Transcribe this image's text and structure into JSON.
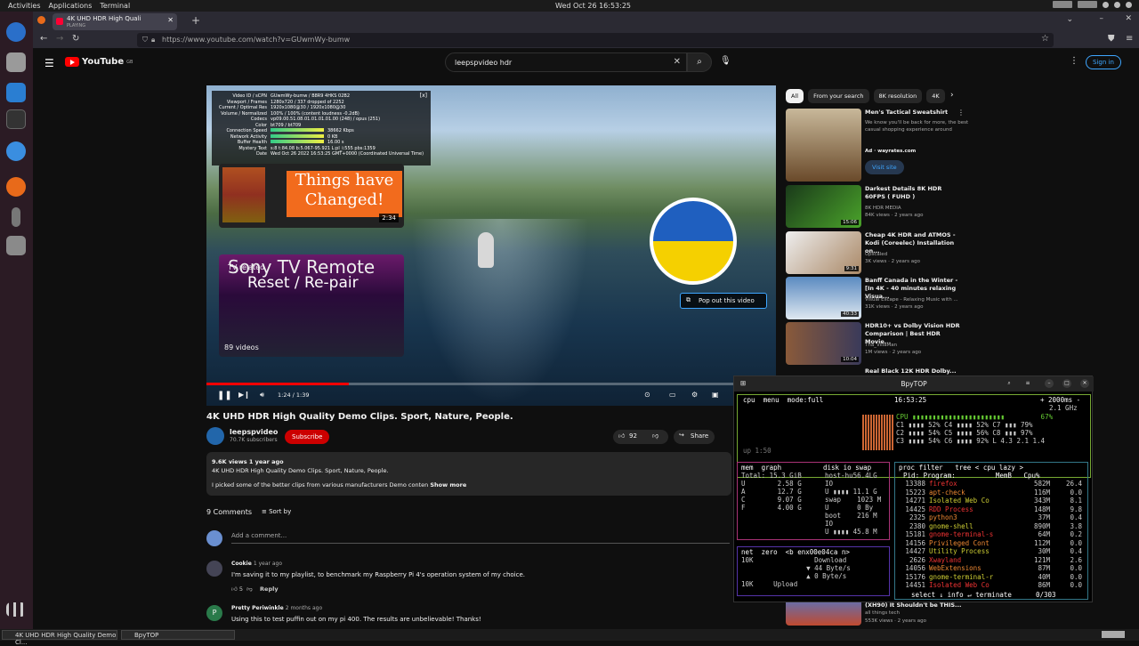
{
  "topbar": {
    "activities": "Activities",
    "applications": "Applications",
    "terminal": "Terminal",
    "clock": "Wed Oct 26  16:53:25"
  },
  "browser": {
    "tab_title": "4K UHD HDR High Quali",
    "tab_status": "PLAYING",
    "url": "https://www.youtube.com/watch?v=GUwmWy-bumw"
  },
  "yt": {
    "logo": "YouTube",
    "region": "GB",
    "search_value": "leepspvideo hdr",
    "signin": "Sign in",
    "video": {
      "stats": [
        [
          "Video ID / sCPN",
          "GUwmWy-bumw  /  B8R9  4HKS  02B2"
        ],
        [
          "Viewport / Frames",
          "1280x720 / 337 dropped of 2252"
        ],
        [
          "Current / Optimal Res",
          "1920x1080@30 / 1920x1080@30"
        ],
        [
          "Volume / Normalized",
          "100% / 100% (content loudness -0.2dB)"
        ],
        [
          "Codecs",
          "vp09.00.51.08.01.01.01.01.00 (248) / opus (251)"
        ],
        [
          "Color",
          "bt709 / bt709"
        ],
        [
          "Connection Speed",
          "38662 Kbps"
        ],
        [
          "Network Activity",
          "0 KB"
        ],
        [
          "Buffer Health",
          "16.00 s"
        ],
        [
          "Mystery Text",
          "s:8 t:84.08 b:5.067-95.921 L:pl_i:555 pbs:1359"
        ],
        [
          "Date",
          "Wed Oct 26 2022 16:53:25 GMT+0000 (Coordinated Universal Time)"
        ]
      ],
      "card1_text": "Things have Changed!",
      "card1_duration": "2:34",
      "card2_line1": "Sony TV Remote",
      "card2_line2": "Reset / Re-pair",
      "card2_tag": "TV related",
      "card2_count": "89 videos",
      "popout": "Pop out this video",
      "time": "1:24 / 1:39",
      "progress": 0.25
    },
    "title": "4K UHD HDR High Quality Demo Clips. Sport, Nature, People.",
    "channel": {
      "name": "leepspvideo",
      "subs": "70.7K subscribers",
      "subscribe": "Subscribe",
      "likes": "92",
      "share": "Share"
    },
    "desc": {
      "views": "9.6K views  1 year ago",
      "line1": "4K UHD HDR High Quality Demo Clips. Sport, Nature, People.",
      "line2": "I picked some of the better clips from various manufacturers Demo conten",
      "more": "Show more"
    },
    "comments": {
      "count": "9 Comments",
      "sort": "Sort by",
      "placeholder": "Add a comment...",
      "items": [
        {
          "author": "Cookie",
          "time": "1 year ago",
          "text": "I'm saving it to my playlist, to benchmark my Raspberry Pi 4's operation system of my choice.",
          "likes": "5",
          "reply": "Reply"
        },
        {
          "author": "Pretty Periwinkle",
          "time": "2 months ago",
          "text": "Using this to test puffin out on my pi 400. The results are unbelievable! Thanks!"
        }
      ]
    },
    "chips": [
      "All",
      "From your search",
      "8K resolution",
      "4K"
    ],
    "recs": [
      {
        "title": "Men's Tactical Sweatshirt",
        "sub": "We know you'll be back for more, the best casual shopping experience around",
        "meta": "Ad · wayrates.com",
        "visit": "Visit site"
      },
      {
        "title": "Darkest Details 8K HDR 60FPS ( FUHD )",
        "ch": "8K HDR MEDIA",
        "meta": "84K views · 2 years ago",
        "dur": "15:06"
      },
      {
        "title": "Cheap 4K HDR and ATMOS - Kodi (Coreelec) Installation on...",
        "ch": "Upscaled",
        "meta": "3K views · 2 years ago",
        "dur": "9:31"
      },
      {
        "title": "Banff Canada in the Winter - [In 4K - 40 minutes relaxing Visua...",
        "ch": "Visual Escape - Relaxing Music with ...",
        "meta": "31K views · 2 years ago",
        "dur": "40:33"
      },
      {
        "title": "HDR10+ vs Dolby Vision HDR Comparison | Best HDR Movie...",
        "ch": "Tha_VillaMan",
        "meta": "1M views · 2 years ago",
        "dur": "10:04"
      },
      {
        "title": "Real Black 12K HDR Dolby..."
      },
      {
        "title": "LG CX OLED vs Sony A90J (XH90) It Shouldn't be THIS...",
        "ch": "all things tech",
        "meta": "553K views · 2 years ago"
      }
    ]
  },
  "btop": {
    "title": "BpyTOP",
    "cpu_header": "cpu  menu  mode:full",
    "clock": "16:53:25",
    "rate": "+ 2000ms -",
    "ghz": "2.1 GHz",
    "cpu_lines": [
      "CPU ▮▮▮▮▮▮▮▮▮▮▮▮▮▮▮▮▮▮▮▮▮▮▮         67%",
      "C1 ▮▮▮▮ 52% C4 ▮▮▮▮ 52% C7 ▮▮▮ 79%",
      "C2 ▮▮▮▮ 54% C5 ▮▮▮▮ 56% C8 ▮▮▮ 97%",
      "C3 ▮▮▮▮ 54% C6 ▮▮▮▮ 92% L 4.3 2.1 1.4"
    ],
    "uptime": "up 1:50",
    "mem_lines": [
      "mem  graph",
      "Total: 15.3 GiB",
      "U        2.58 G",
      "A        12.7 G",
      "C        9.07 G",
      "F        4.00 G"
    ],
    "disk_lines": [
      "disk io swap",
      "host-hu56.4LG",
      "IO",
      "U ▮▮▮▮ 11.1 G",
      "swap    1023 M",
      "U       0 By",
      "boot    216 M",
      "IO",
      "U ▮▮▮▮ 45.8 M"
    ],
    "proc_header": "proc filter   tree < cpu lazy >",
    "proc_cols": "  Pid: Program:          MemB   Cpu%",
    "procs": [
      [
        "13388",
        "firefox",
        "582M",
        "26.4"
      ],
      [
        "15223",
        "apt-check",
        "116M",
        "0.0"
      ],
      [
        "14271",
        "Isolated Web Co",
        "343M",
        "8.1"
      ],
      [
        "14425",
        "RDD Process",
        "148M",
        "9.8"
      ],
      [
        "2325",
        "python3",
        "37M",
        "0.4"
      ],
      [
        "2380",
        "gnome-shell",
        "890M",
        "3.8"
      ],
      [
        "15181",
        "gnome-terminal-s",
        "64M",
        "0.2"
      ],
      [
        "14156",
        "Privileged Cont",
        "112M",
        "0.0"
      ],
      [
        "14427",
        "Utility Process",
        "30M",
        "0.4"
      ],
      [
        "2626",
        "Xwayland",
        "121M",
        "2.6"
      ],
      [
        "14056",
        "WebExtensions",
        "87M",
        "0.0"
      ],
      [
        "15176",
        "gnome-terminal-r",
        "40M",
        "0.0"
      ],
      [
        "14451",
        "Isolated Web Co",
        "86M",
        "0.0"
      ]
    ],
    "proc_footer": "select ↓ info ↵ terminate      0/303",
    "net_header": "net  zero  <b enx00e04ca n>",
    "net_lines": [
      "10K",
      "        Download",
      "      ▼ 44 Byte/s",
      "      ▲ 0 Byte/s",
      "10K     Upload"
    ]
  },
  "taskbar": {
    "item1": "4K UHD HDR High Quality Demo Cl...",
    "item2": "BpyTOP"
  }
}
